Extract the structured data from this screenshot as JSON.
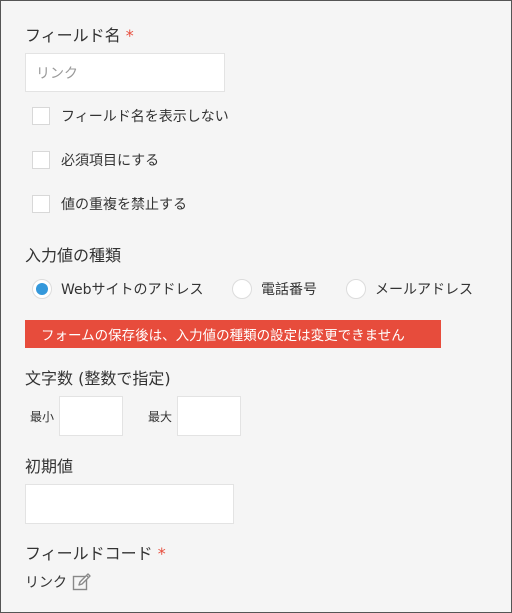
{
  "field_name": {
    "label": "フィールド名",
    "required_mark": "*",
    "input_placeholder": "リンク"
  },
  "checkboxes": [
    {
      "label": "フィールド名を表示しない",
      "checked": false
    },
    {
      "label": "必須項目にする",
      "checked": false
    },
    {
      "label": "値の重複を禁止する",
      "checked": false
    }
  ],
  "input_type": {
    "label": "入力値の種類",
    "options": [
      {
        "label": "Webサイトのアドレス",
        "selected": true
      },
      {
        "label": "電話番号",
        "selected": false
      },
      {
        "label": "メールアドレス",
        "selected": false
      }
    ],
    "warning": "フォームの保存後は、入力値の種類の設定は変更できません"
  },
  "char_count": {
    "label": "文字数 (整数で指定)",
    "min_label": "最小",
    "max_label": "最大",
    "min_value": "",
    "max_value": ""
  },
  "default_value": {
    "label": "初期値",
    "value": ""
  },
  "field_code": {
    "label": "フィールドコード",
    "required_mark": "*",
    "value": "リンク",
    "edit_icon": "edit-pencil-icon"
  },
  "colors": {
    "required": "#e74c3c",
    "radio_selected": "#3498db",
    "alert_background": "#e74c3c",
    "panel_background": "#f5f5f5"
  }
}
